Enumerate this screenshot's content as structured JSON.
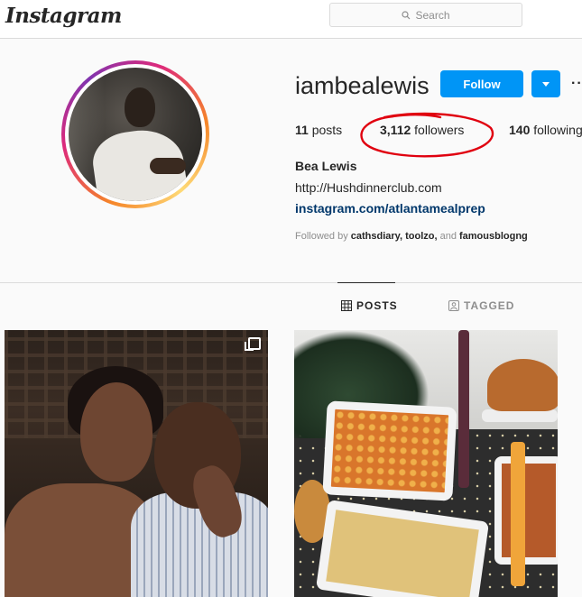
{
  "nav": {
    "logo": "Instagram",
    "search_placeholder": "Search"
  },
  "profile": {
    "username": "iambealewis",
    "follow_label": "Follow",
    "more_label": "···",
    "stats": {
      "posts_count": "11",
      "posts_label": " posts",
      "followers_count": "3,112",
      "followers_label": " followers",
      "following_count": "140",
      "following_label": " following"
    },
    "full_name": "Bea Lewis",
    "website": "http://Hushdinnerclub.com",
    "link": "instagram.com/atlantamealprep",
    "followed_by_prefix": "Followed by ",
    "followed_by_names": "cathsdiary, toolzo,",
    "followed_by_and": " and ",
    "followed_by_last": "famousblogng"
  },
  "tabs": [
    {
      "label": "POSTS",
      "icon": "grid-icon",
      "active": true
    },
    {
      "label": "TAGGED",
      "icon": "tagged-icon",
      "active": false
    }
  ],
  "annotation": {
    "color": "#e0000f"
  },
  "colors": {
    "accent": "#0095f6",
    "link": "#00376b"
  }
}
